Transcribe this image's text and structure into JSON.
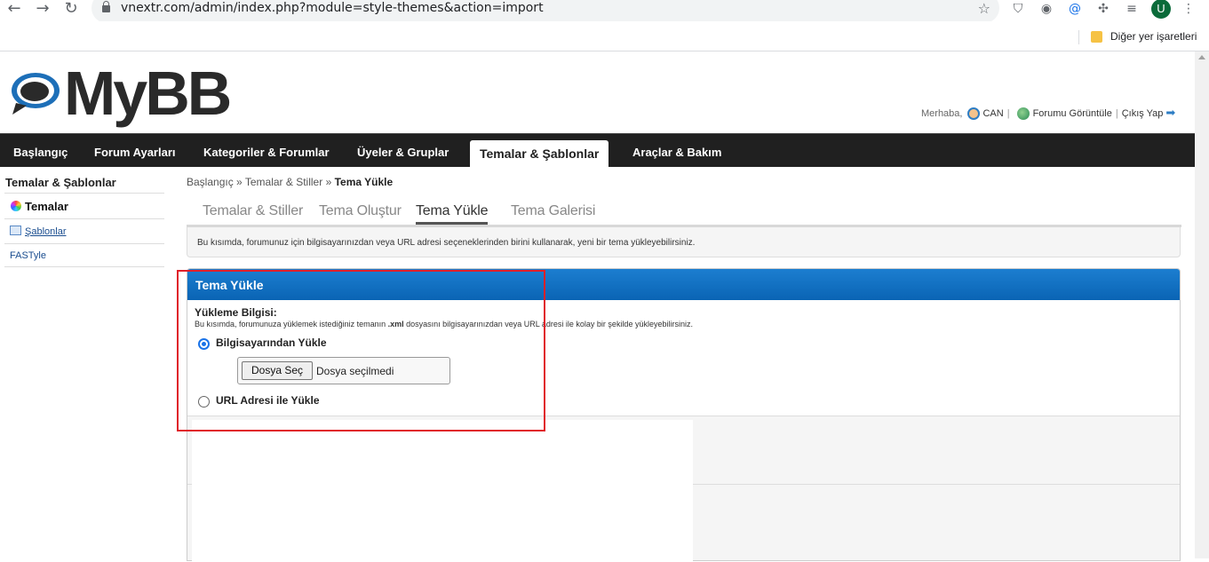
{
  "browser": {
    "url": "vnextr.com/admin/index.php?module=style-themes&action=import",
    "profile_initial": "U",
    "bookmarks_folder": "Diğer yer işaretleri"
  },
  "header": {
    "logo_text": "MyBB",
    "greeting": "Merhaba,",
    "username": "CAN",
    "view_forum": "Forumu Görüntüle",
    "logout": "Çıkış Yap"
  },
  "main_nav": [
    "Başlangıç",
    "Forum Ayarları",
    "Kategoriler & Forumlar",
    "Üyeler & Gruplar",
    "Temalar & Şablonlar",
    "Araçlar & Bakım"
  ],
  "sidebar": {
    "title": "Temalar & Şablonlar",
    "items": [
      "Temalar",
      "Şablonlar",
      "FASTyle"
    ]
  },
  "breadcrumb": {
    "home": "Başlangıç",
    "sep": "»",
    "parent": "Temalar & Stiller",
    "current": "Tema Yükle"
  },
  "tabs": [
    "Temalar & Stiller",
    "Tema Oluştur",
    "Tema Yükle",
    "Tema Galerisi"
  ],
  "description": "Bu kısımda, forumunuz için bilgisayarınızdan veya URL adresi seçeneklerinden birini kullanarak, yeni bir tema yükleyebilirsiniz.",
  "panel": {
    "title": "Tema Yükle",
    "field_label": "Yükleme Bilgisi:",
    "field_desc_before": "Bu kısımda, forumunuza yüklemek istediğiniz temanın",
    "field_desc_ext": ".xml",
    "field_desc_after": "dosyasını bilgisayarınızdan veya URL adresi ile kolay bir şekilde yükleyebilirsiniz.",
    "option_local": "Bilgisayarından Yükle",
    "option_url": "URL Adresi ile Yükle",
    "file_button": "Dosya Seç",
    "file_status": "Dosya seçilmedi",
    "selected_option": "local"
  },
  "colors": {
    "nav_bg": "#202020",
    "panel_header": "#0a64b4",
    "highlight_border": "#e0202a"
  }
}
